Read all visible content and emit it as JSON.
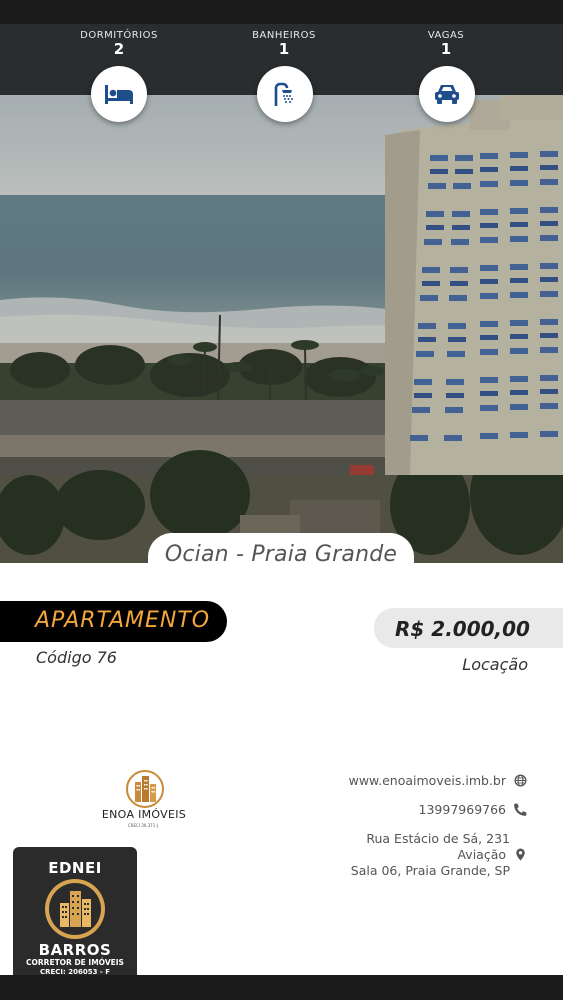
{
  "stats": [
    {
      "label": "DORMITÓRIOS",
      "value": "2",
      "icon": "bed-icon"
    },
    {
      "label": "BANHEIROS",
      "value": "1",
      "icon": "shower-icon"
    },
    {
      "label": "VAGAS",
      "value": "1",
      "icon": "car-icon"
    }
  ],
  "listing": {
    "location": "Ocian - Praia Grande",
    "type": "APARTAMENTO",
    "code": "Código 76",
    "price": "R$ 2.000,00",
    "deal": "Locação"
  },
  "agency": {
    "name": "ENOA IMÓVEIS",
    "tagline": "CRECI 30.371-J",
    "website": "www.enoaimoveis.imb.br",
    "phone": "13997969766",
    "address_line1": "Rua Estácio de Sá, 231",
    "address_line2": "Aviação",
    "address_line3": "Sala 06, Praia Grande, SP"
  },
  "broker": {
    "first_name": "EDNEI",
    "last_name": "BARROS",
    "role": "CORRETOR DE IMÓVEIS",
    "creci": "CRECI: 206053 - F"
  },
  "colors": {
    "accent": "#f4a63a",
    "icon_blue": "#1f4e8c",
    "dark": "#2a2d2f"
  }
}
